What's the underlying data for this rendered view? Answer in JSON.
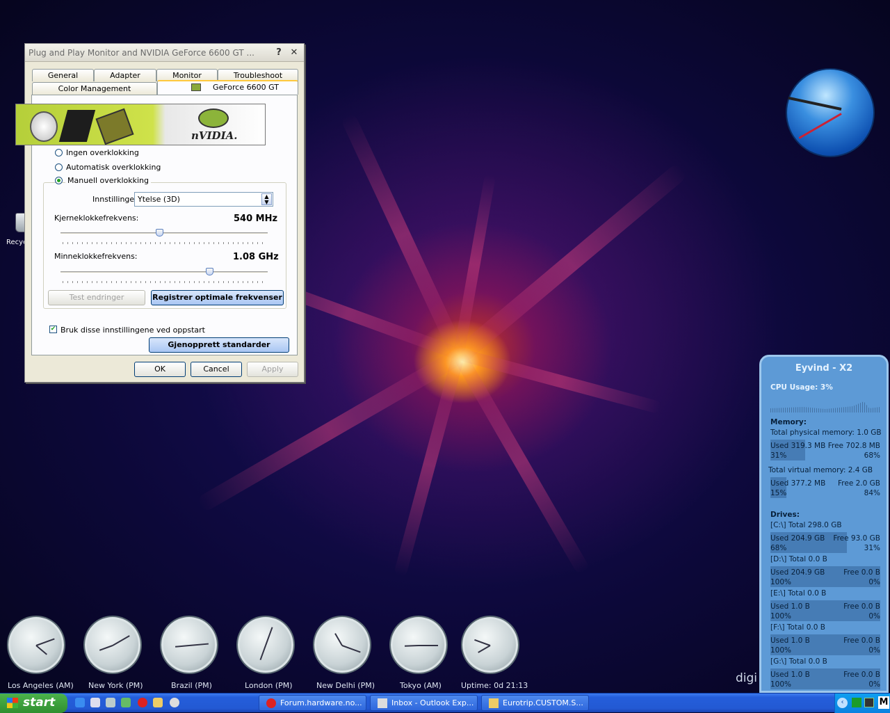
{
  "dialog": {
    "title": "Plug and Play Monitor and NVIDIA GeForce 6600 GT ...",
    "help_glyph": "?",
    "close_glyph": "✕",
    "tabs_row1": [
      "General",
      "Adapter",
      "Monitor",
      "Troubleshoot"
    ],
    "tabs_row2": [
      "Color Management",
      "GeForce 6600 GT"
    ],
    "banner_logo": "nVIDIA.",
    "radio_none": "Ingen overklokking",
    "radio_auto": "Automatisk overklokking",
    "radio_manual": "Manuell overklokking",
    "settings_label": "Innstillinger",
    "settings_value": "Ytelse (3D)",
    "core_label": "Kjerneklokkefrekvens:",
    "core_value": "540 MHz",
    "core_level": 0.48,
    "mem_label": "Minneklokkefrekvens:",
    "mem_value": "1.08 GHz",
    "mem_level": 0.72,
    "test_button": "Test endringer",
    "detect_button": "Registrer optimale frekvenser",
    "startup_checkbox": "Bruk disse innstillingene ved oppstart",
    "restore_button": "Gjenopprett standarder",
    "ok": "OK",
    "cancel": "Cancel",
    "apply": "Apply"
  },
  "desktop": {
    "recycle_label": "Recyc",
    "corner_text": "digi"
  },
  "clocks": [
    {
      "label": "Los Angeles (AM)"
    },
    {
      "label": "New York (PM)"
    },
    {
      "label": "Brazil (PM)"
    },
    {
      "label": "London (PM)"
    },
    {
      "label": "New Delhi (PM)"
    },
    {
      "label": "Tokyo (AM)"
    },
    {
      "label": "Uptime: 0d 21:13"
    }
  ],
  "sysinfo": {
    "title": "Eyvind - X2",
    "cpu": "CPU Usage: 3%",
    "memory_heading": "Memory:",
    "phys_total": "Total physical memory: 1.0 GB",
    "phys_used": "Used 319.3 MB",
    "phys_free": "Free 702.8 MB",
    "phys_used_pct": "31%",
    "phys_free_pct": "68%",
    "virt_total": "Total virtual memory: 2.4 GB",
    "virt_used": "Used 377.2 MB",
    "virt_free": "Free 2.0 GB",
    "virt_used_pct": "15%",
    "virt_free_pct": "84%",
    "drives_heading": "Drives:",
    "drives": [
      {
        "total": "[C:\\] Total 298.0 GB",
        "used": "Used 204.9 GB",
        "free": "Free 93.0 GB",
        "used_pct": "68%",
        "free_pct": "31%"
      },
      {
        "total": "[D:\\] Total 0.0 B",
        "used": "Used 204.9 GB",
        "free": "Free 0.0 B",
        "used_pct": "100%",
        "free_pct": "0%"
      },
      {
        "total": "[E:\\] Total 0.0 B",
        "used": "Used 1.0 B",
        "free": "Free 0.0 B",
        "used_pct": "100%",
        "free_pct": "0%"
      },
      {
        "total": "[F:\\] Total 0.0 B",
        "used": "Used 1.0 B",
        "free": "Free 0.0 B",
        "used_pct": "100%",
        "free_pct": "0%"
      },
      {
        "total": "[G:\\] Total 0.0 B",
        "used": "Used 1.0 B",
        "free": "Free 0.0 B",
        "used_pct": "100%",
        "free_pct": "0%"
      }
    ]
  },
  "taskbar": {
    "start": "start",
    "tasks": [
      "Forum.hardware.no...",
      "Inbox - Outlook Exp...",
      "Eurotrip.CUSTOM.S..."
    ]
  }
}
